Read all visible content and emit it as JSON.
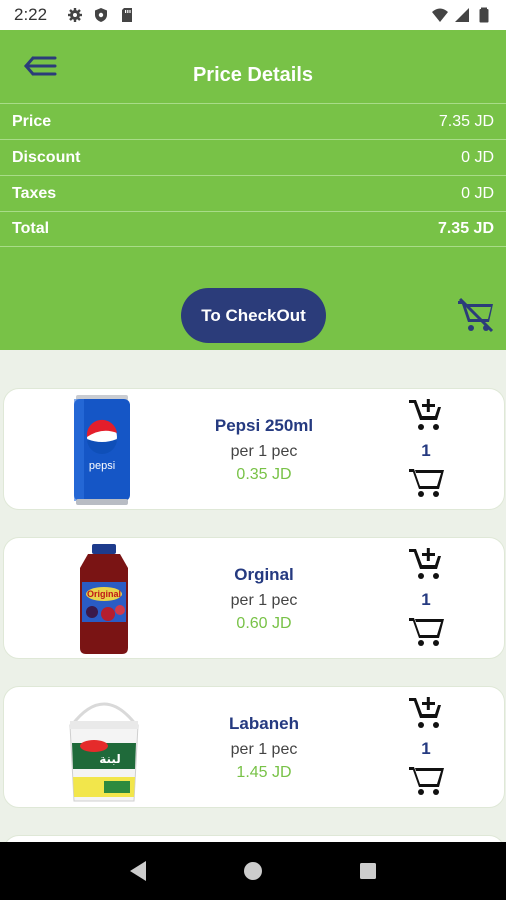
{
  "status_bar": {
    "time": "2:22",
    "icons": [
      "settings-icon",
      "shield-icon",
      "sdcard-icon",
      "wifi-icon",
      "signal-icon",
      "battery-icon"
    ]
  },
  "header": {
    "title": "Price Details",
    "back_icon": "menu-back-icon"
  },
  "price_details": [
    {
      "label": "Price",
      "value": "7.35 JD"
    },
    {
      "label": "Discount",
      "value": "0 JD"
    },
    {
      "label": "Taxes",
      "value": "0 JD"
    },
    {
      "label": "Total",
      "value": "7.35 JD"
    }
  ],
  "checkout_label": "To CheckOut",
  "clear_cart_icon": "remove-shopping-cart-icon",
  "products": [
    {
      "name": "Pepsi 250ml",
      "unit": "per 1 pec",
      "price": "0.35 JD",
      "qty": "1",
      "image": "pepsi-can"
    },
    {
      "name": "Orginal",
      "unit": "per 1 pec",
      "price": "0.60 JD",
      "qty": "1",
      "image": "juice-bottle"
    },
    {
      "name": "Labaneh",
      "unit": "per 1 pec",
      "price": "1.45 JD",
      "qty": "1",
      "image": "labaneh-tub"
    }
  ],
  "nav": [
    "back-icon",
    "home-icon",
    "recents-icon"
  ],
  "colors": {
    "header_green": "#78c247",
    "checkout_navy": "#2b3c7a",
    "price_green": "#78c247",
    "name_navy": "#253a80"
  }
}
